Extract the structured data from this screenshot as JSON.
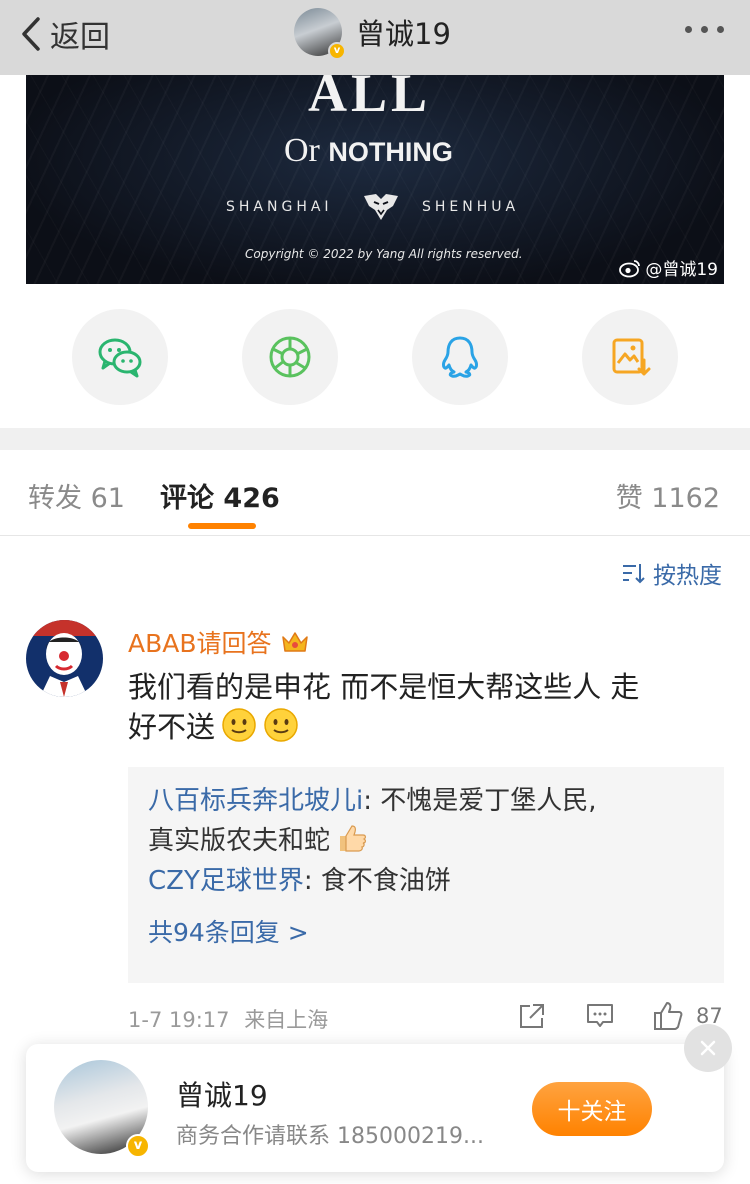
{
  "nav": {
    "back_label": "返回",
    "user_name": "曾诚19"
  },
  "banner": {
    "title_top": "ALL",
    "title_or": "Or",
    "title_nothing": "NOTHING",
    "club_left": "SHANGHAI",
    "club_right": "SHENHUA",
    "copyright": "Copyright © 2022 by Yang All rights reserved.",
    "watermark": "@曾诚19"
  },
  "share": {
    "items": [
      "wechat-icon",
      "moments-icon",
      "qq-icon",
      "save-image-icon"
    ],
    "colors": {
      "wechat": "#2ab56f",
      "moments": "#5ac25e",
      "qq": "#2aa3e6",
      "save": "#f6a623"
    }
  },
  "tabs": {
    "repost_label": "转发",
    "repost_count": "61",
    "comment_label": "评论",
    "comment_count": "426",
    "like_label": "赞",
    "like_count": "1162"
  },
  "sort_label": "按热度",
  "comment": {
    "author": "ABAB请回答",
    "text_line1": "我们看的是申花 而不是恒大帮这些人 走",
    "text_line2": "好不送",
    "replies": [
      {
        "name": "八百标兵奔北坡儿i",
        "sep": ": ",
        "text_a": "不愧是爱丁堡人民,",
        "text_b": "真实版农夫和蛇"
      },
      {
        "name": "CZY足球世界",
        "sep": ": ",
        "text_a": "食不食油饼"
      }
    ],
    "more_replies": "共94条回复 >",
    "time": "1-7 19:17",
    "source": "来自上海",
    "like_count": "87"
  },
  "follow_card": {
    "name": "曾诚19",
    "desc": "商务合作请联系 185000219...",
    "follow_label": "十关注"
  },
  "colors": {
    "accent": "#ff8200",
    "link": "#3a6aa8",
    "author": "#e8731e"
  }
}
